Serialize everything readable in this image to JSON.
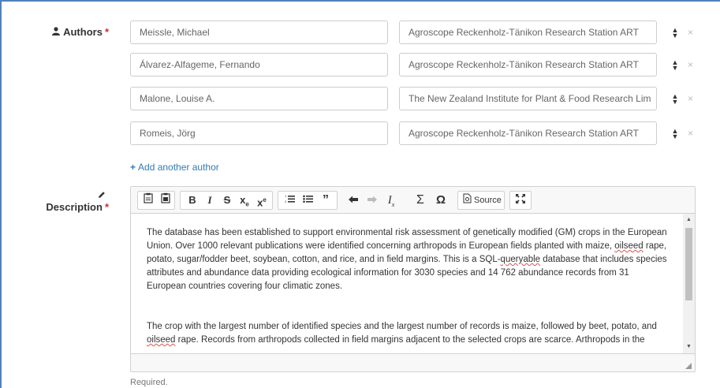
{
  "authors": {
    "label": "Authors",
    "required_mark": "*",
    "icon": "user-icon",
    "rows": [
      {
        "name": "Meissle, Michael",
        "affiliation": "Agroscope Reckenholz-Tänikon Research Station ART"
      },
      {
        "name": "Álvarez-Alfageme, Fernando",
        "affiliation": "Agroscope Reckenholz-Tänikon Research Station ART"
      },
      {
        "name": "Malone, Louise A.",
        "affiliation": "The New Zealand Institute for Plant & Food Research Lim"
      },
      {
        "name": "Romeis, Jörg",
        "affiliation": "Agroscope Reckenholz-Tänikon Research Station ART"
      }
    ],
    "sort_icon": "sort-icon",
    "remove_glyph": "×",
    "add_label": "Add another author"
  },
  "description": {
    "label": "Description",
    "required_mark": "*",
    "icon": "pencil-icon",
    "toolbar": {
      "source_label": "Source",
      "buttons": [
        "paste-text",
        "paste-word",
        "bold",
        "italic",
        "strike",
        "subscript",
        "superscript",
        "numbered-list",
        "bulleted-list",
        "blockquote",
        "undo",
        "redo",
        "remove-format",
        "formula",
        "special-char",
        "source",
        "maximize"
      ]
    },
    "paragraph_1": {
      "a": "The database has been established to support environmental risk assessment of genetically modified (GM) crops in the European Union. Over 1000 relevant publications were identified concerning arthropods in European fields planted with maize, ",
      "b": "oilseed",
      "c": " rape, potato, sugar/fodder beet, soybean, cotton, and rice, and in field margins. This is a SQL-",
      "d": "queryable",
      "e": " database that includes species attributes and abundance data providing ecological information for 3030 species and 14 762 abundance records from 31 European countries covering four climatic zones."
    },
    "paragraph_2": {
      "a": "The crop with the largest number of identified species and the largest number of records is maize, followed by beet, potato, and ",
      "b": "oilseed",
      "c": " rape. Records from arthropods collected in field margins adjacent to the selected crops are scarce. Arthropods in the"
    },
    "help_text": "Required."
  }
}
